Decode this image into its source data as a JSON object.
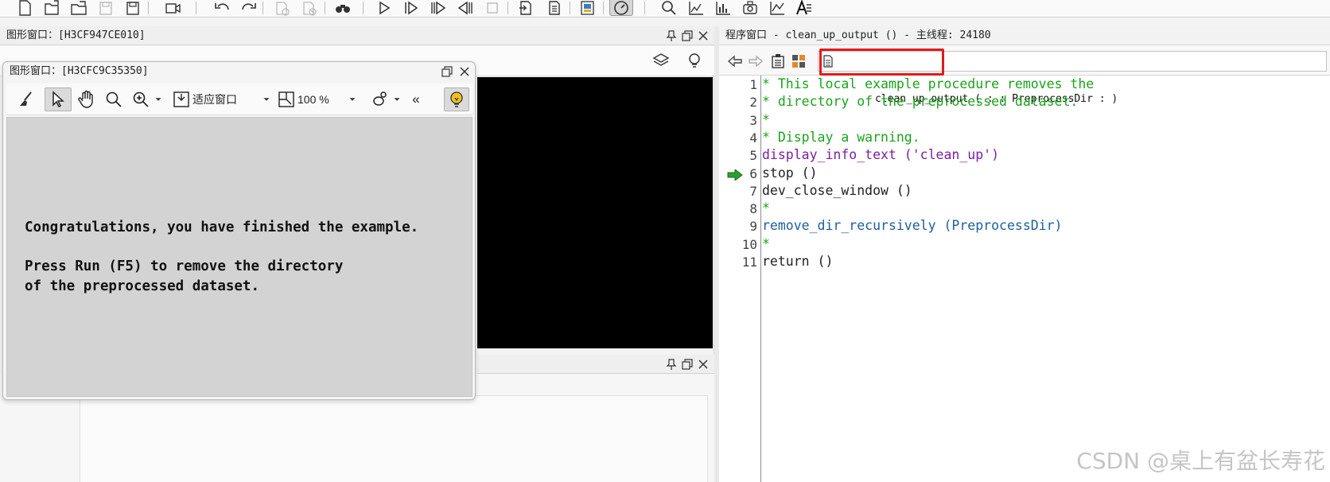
{
  "main_toolbar": {
    "icons": [
      "new-file-icon",
      "open-file-icon",
      "open-folder-icon",
      "save-disabled-icon",
      "save-all-icon",
      "record-icon",
      "undo-icon",
      "redo-icon",
      "list-disabled-icon",
      "list-remove-disabled-icon",
      "binoculars-icon",
      "run-icon",
      "step-over-icon",
      "step-into-icon",
      "step-out-icon",
      "stop-icon",
      "insert-icon",
      "program-icon",
      "assistant-icon",
      "profiler-icon",
      "search-icon",
      "chart-icon",
      "histogram-icon",
      "camera-icon",
      "line-profile-icon",
      "text-icon"
    ]
  },
  "graphics_window_back": {
    "title": "图形窗口：[H3CF947CE010]"
  },
  "graphics_window_front": {
    "title": "图形窗口：[H3CFC9C35350]",
    "toolbar": {
      "fit_label": "适应窗口",
      "zoom_label": "100 %",
      "collapse_label": "«"
    },
    "message_lines": [
      "Congratulations, you have finished the example.",
      "",
      "Press Run (F5) to remove the directory",
      "of the preprocessed dataset."
    ]
  },
  "program_window": {
    "title": "程序窗口 - clean_up_output () - 主线程: 24180",
    "procedure_signature": "clean_up_output ( : : PreprocessDir : )",
    "current_line": 6,
    "lines": [
      {
        "num": "1",
        "text": "* This local example procedure removes the",
        "kind": "comment"
      },
      {
        "num": "2",
        "text": "* directory of the preprocessed dataset.",
        "kind": "comment"
      },
      {
        "num": "3",
        "text": "*",
        "kind": "comment"
      },
      {
        "num": "4",
        "text": "* Display a warning.",
        "kind": "comment"
      },
      {
        "num": "5",
        "text": "display_info_text ('clean_up')",
        "kind": "proc"
      },
      {
        "num": "6",
        "text": "stop ()",
        "kind": "op"
      },
      {
        "num": "7",
        "text": "dev_close_window ()",
        "kind": "op"
      },
      {
        "num": "8",
        "text": "*",
        "kind": "comment"
      },
      {
        "num": "9",
        "text": "remove_dir_recursively (PreprocessDir)",
        "kind": "ext"
      },
      {
        "num": "10",
        "text": "*",
        "kind": "comment"
      },
      {
        "num": "11",
        "text": "return ()",
        "kind": "op"
      }
    ]
  },
  "watermark": "CSDN @桌上有盆长寿花",
  "colors": {
    "comment": "#1ca31c",
    "procedure": "#7b1fa2",
    "external": "#1e5da0",
    "highlight_box": "#e11b1b",
    "pc_arrow": "#2e9e2e"
  }
}
